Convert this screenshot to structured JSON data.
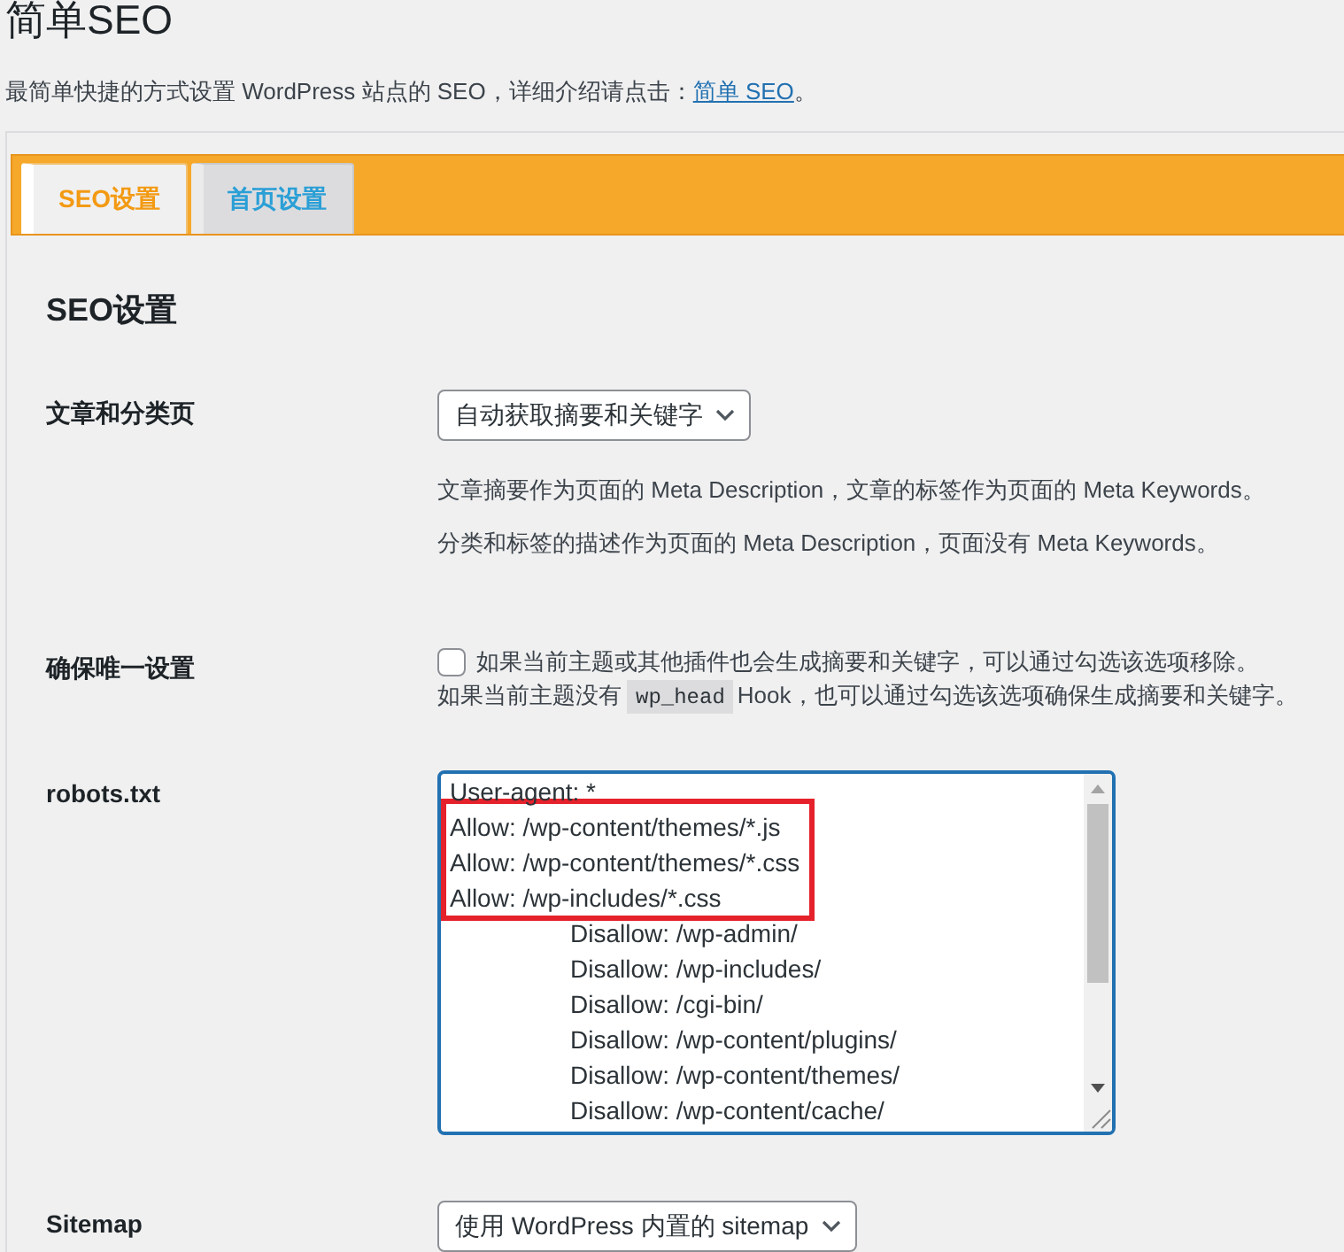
{
  "page": {
    "title": "简单SEO",
    "intro": {
      "text": "最简单快捷的方式设置 WordPress 站点的 SEO，详细介绍请点击：",
      "link": "简单 SEO",
      "end": "。"
    }
  },
  "tabs": [
    {
      "label": "SEO设置",
      "selected": true
    },
    {
      "label": "首页设置",
      "selected": false
    }
  ],
  "section_title": "SEO设置",
  "fields": [
    {
      "kind": "select",
      "label": "文章和分类页",
      "value": "自动获取摘要和关键字",
      "notes": [
        "文章摘要作为页面的 Meta Description，文章的标签作为页面的 Meta Keywords。",
        "分类和标签的描述作为页面的 Meta Description，页面没有 Meta Keywords。"
      ]
    },
    {
      "kind": "checkbox",
      "label": "确保唯一设置",
      "checked": false,
      "text": "如果当前主题或其他插件也会生成摘要和关键字，可以通过勾选该选项移除。",
      "note": {
        "before": "如果当前主题没有",
        "code": "wp_head",
        "after": "Hook，也可以通过勾选该选项确保生成摘要和关键字。"
      }
    },
    {
      "kind": "textarea",
      "label": "robots.txt",
      "lines": [
        {
          "text": "User-agent: *",
          "indented": false,
          "highlighted": false
        },
        {
          "text": "Allow: /wp-content/themes/*.js",
          "indented": false,
          "highlighted": true
        },
        {
          "text": "Allow: /wp-content/themes/*.css",
          "indented": false,
          "highlighted": true
        },
        {
          "text": "Allow: /wp-includes/*.css",
          "indented": false,
          "highlighted": true
        },
        {
          "text": "Disallow: /wp-admin/",
          "indented": true,
          "highlighted": false
        },
        {
          "text": "Disallow: /wp-includes/",
          "indented": true,
          "highlighted": false
        },
        {
          "text": "Disallow: /cgi-bin/",
          "indented": true,
          "highlighted": false
        },
        {
          "text": "Disallow: /wp-content/plugins/",
          "indented": true,
          "highlighted": false
        },
        {
          "text": "Disallow: /wp-content/themes/",
          "indented": true,
          "highlighted": false
        },
        {
          "text": "Disallow: /wp-content/cache/",
          "indented": true,
          "highlighted": false
        }
      ]
    },
    {
      "kind": "select",
      "label": "Sitemap",
      "value": "使用 WordPress 内置的 sitemap"
    }
  ]
}
